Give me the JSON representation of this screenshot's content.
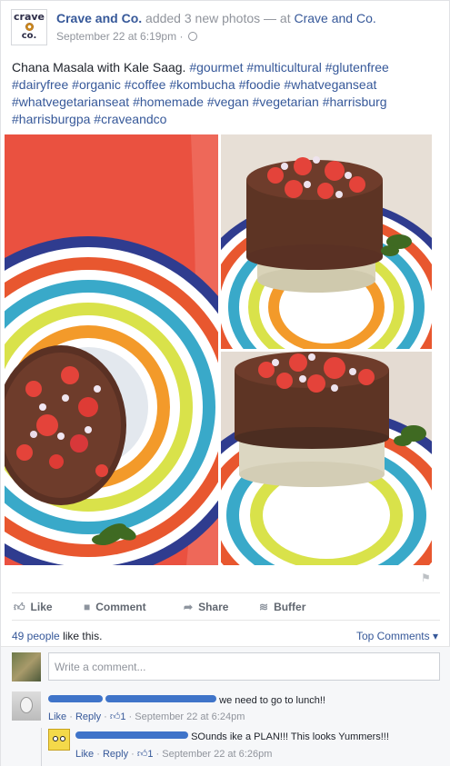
{
  "post": {
    "page_name": "Crave and Co.",
    "action_text": "added 3 new photos — at",
    "location": "Crave and Co.",
    "date": "September 22 at 6:19pm",
    "avatar_line1": "crave",
    "avatar_line2": "co.",
    "message_title": "Chana Masala with Kale Saag.",
    "hashtags": [
      "#gourmet",
      "#multicultural",
      "#glutenfree",
      "#dairyfree",
      "#organic",
      "#coffee",
      "#kombucha",
      "#foodie",
      "#whatveganseat",
      "#whatvegetarianseat",
      "#homemade",
      "#vegan",
      "#vegetarian",
      "#harrisburg",
      "#harrisburgpa",
      "#craveandco"
    ]
  },
  "actions": {
    "like": "Like",
    "comment": "Comment",
    "share": "Share",
    "buffer": "Buffer"
  },
  "likes": {
    "count_text": "49 people",
    "suffix": "like this.",
    "top_comments": "Top Comments ▾"
  },
  "comment_box": {
    "placeholder": "Write a comment..."
  },
  "comments": [
    {
      "text": "we need to go to lunch!!",
      "like": "Like",
      "reply": "Reply",
      "likes": "1",
      "date": "September 22 at 6:24pm"
    },
    {
      "text": "SOunds ike a PLAN!!! This looks Yummers!!!",
      "like": "Like",
      "reply": "Reply",
      "likes": "1",
      "date": "September 22 at 6:26pm"
    }
  ],
  "icons": {
    "like": "thumbs-up-icon",
    "comment": "speech-bubble-icon",
    "share": "share-arrow-icon",
    "buffer": "buffer-stack-icon",
    "privacy": "globe-icon",
    "report": "flag-icon"
  },
  "colors": {
    "link": "#365899",
    "muted": "#90949c",
    "redaction": "#3f74c9"
  }
}
